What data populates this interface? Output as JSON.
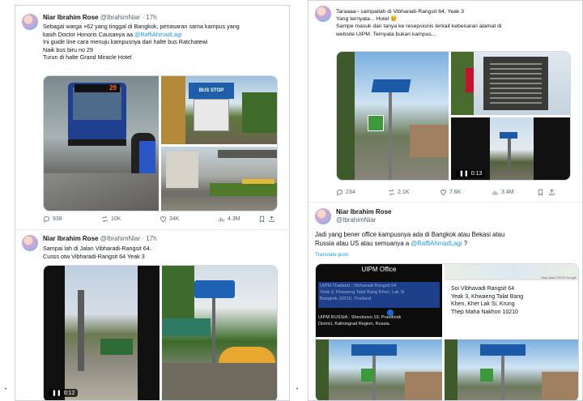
{
  "tweet1": {
    "name": "Niar Ibrahim Rose",
    "handle": "@IbrahimNiar",
    "time": "· 17h",
    "lines": [
      "Sebagai warga +62 yang tinggal di Bangkok, penasaran sama kampus yang",
      "kasih Doctor Honoris Causanya aa ",
      "Ini guide line cara menuju kampusnya dari halte bus Ratchatewi",
      "Naik bus biru no 29",
      "Turun di halte Grand Miracle Hotel"
    ],
    "mention": "@RaffiAhmadLagi",
    "bus_number": "29",
    "sign_text": "BUS STOP",
    "stats": {
      "replies": "938",
      "reposts": "10K",
      "likes": "34K",
      "views": "4.3M"
    }
  },
  "tweet2": {
    "name": "Niar Ibrahim Rose",
    "handle": "@IbrahimNiar",
    "time": "· 17h",
    "lines": [
      "Sampai lah di Jalan Vibharadi-Rangsit 64.",
      "Cusss otw Vibharadi-Rangsit 64 Yeak 3"
    ],
    "video_time": "0:12"
  },
  "tweet3": {
    "lines": [
      "Taraaaa~ sampailah di Vibharadi-Rangsit 64, Yeak 3",
      "Yang ternyata... Hotel 😢",
      "Sampe masuk dan tanya ke resepsionis terkait kebenaran alamat di",
      "website UIPM. Ternyata bukan kampus..."
    ],
    "video_time": "0:13",
    "stats": {
      "replies": "234",
      "reposts": "2.1K",
      "likes": "7.6K",
      "views": "3.4M"
    }
  },
  "tweet4": {
    "name": "Niar Ibrahim Rose",
    "handle": "@IbrahimNiar",
    "lines": [
      "Jadi yang bener office kampusnya ada di Bangkok atau Bekasi atau",
      "Russia atau US atau semuanya a ",
      " ?"
    ],
    "mention": "@RaffiAhmadLagi",
    "translate": "Translate post",
    "card_title": "UIPM Office",
    "card_thailand": [
      "UIPM Thailand : Vibhavadi Rangsit 64",
      "Yeak 3, Khwaeng Talat Bang Khen, Lak Si",
      "Bangkok 10210, Thailand"
    ],
    "card_russia": [
      "UIPM RUSSIA : Shevtsovo 19, Pravdinsk",
      "District, Kaliningrad Region, Russia."
    ],
    "map_credit": "Map data ©2024 Google",
    "map_address": [
      "Soi Vibhavadi Rangsit 64",
      "Yeak 3, Khwaeng Talat Bang",
      "Khen, Khet Lak Si, Krung",
      "Thep Maha Nakhon 10210"
    ]
  }
}
